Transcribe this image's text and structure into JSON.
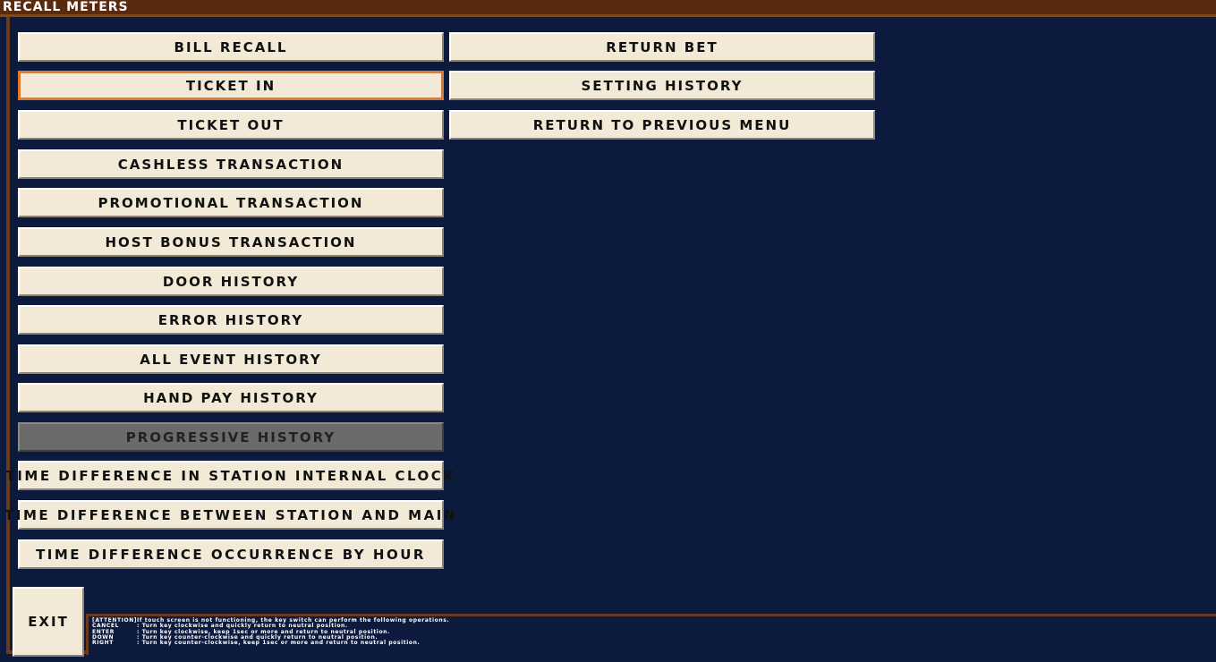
{
  "header": {
    "title": "RECALL METERS"
  },
  "left_menu": [
    {
      "label": "BILL RECALL",
      "state": "normal"
    },
    {
      "label": "TICKET IN",
      "state": "selected"
    },
    {
      "label": "TICKET OUT",
      "state": "normal"
    },
    {
      "label": "CASHLESS TRANSACTION",
      "state": "normal"
    },
    {
      "label": "PROMOTIONAL TRANSACTION",
      "state": "normal"
    },
    {
      "label": "HOST BONUS TRANSACTION",
      "state": "normal"
    },
    {
      "label": "DOOR HISTORY",
      "state": "normal"
    },
    {
      "label": "ERROR HISTORY",
      "state": "normal"
    },
    {
      "label": "ALL EVENT HISTORY",
      "state": "normal"
    },
    {
      "label": "HAND PAY HISTORY",
      "state": "normal"
    },
    {
      "label": "PROGRESSIVE HISTORY",
      "state": "disabled"
    },
    {
      "label": "TIME DIFFERENCE IN STATION INTERNAL CLOCK",
      "state": "normal"
    },
    {
      "label": "TIME DIFFERENCE BETWEEN STATION AND MAIN",
      "state": "normal"
    },
    {
      "label": "TIME DIFFERENCE OCCURRENCE BY HOUR",
      "state": "normal"
    }
  ],
  "right_menu": [
    {
      "label": "RETURN BET",
      "state": "normal"
    },
    {
      "label": "SETTING HISTORY",
      "state": "normal"
    },
    {
      "label": "RETURN TO PREVIOUS MENU",
      "state": "normal"
    }
  ],
  "footer": {
    "exit_label": "EXIT",
    "attention": [
      {
        "key": "[ATTENTION]",
        "text": "If touch screen is not functioning, the key switch can perform the following operations."
      },
      {
        "key": "CANCEL",
        "text": ": Turn key clockwise and quickly return to neutral position."
      },
      {
        "key": "ENTER",
        "text": ": Turn key clockwise, keep 1sec or more and return to neutral position."
      },
      {
        "key": "DOWN",
        "text": ": Turn key counter-clockwise and quickly return to neutral position."
      },
      {
        "key": "RIGHT",
        "text": ": Turn key counter-clockwise, keep 1sec or more and return to neutral position."
      }
    ]
  },
  "colors": {
    "background": "#0c1a3d",
    "title_bar": "#5a2a0e",
    "frame": "#6b3a18",
    "button_face": "#f3e9d7",
    "selected_border": "#e07a2a",
    "disabled_face": "#6a6a6a"
  }
}
